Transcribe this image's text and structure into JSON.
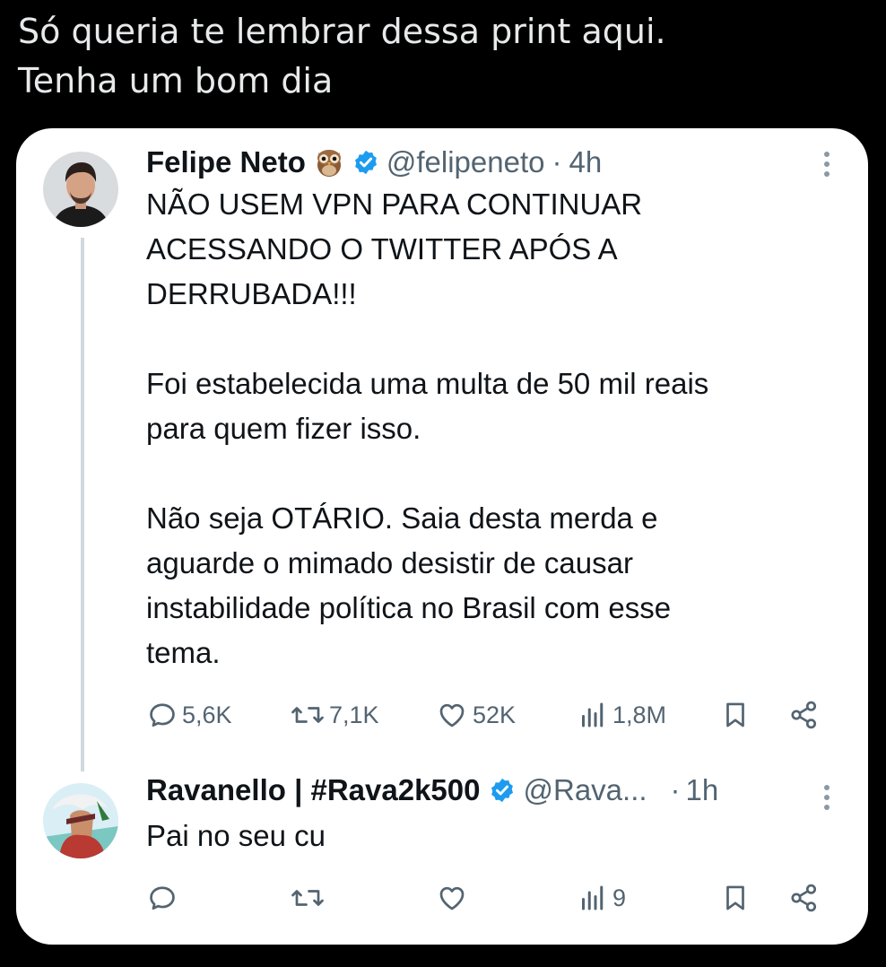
{
  "caption": {
    "line1": "Só queria te lembrar dessa print aqui.",
    "line2": "Tenha um bom dia"
  },
  "tweet1": {
    "name": "Felipe Neto",
    "handle": "@felipeneto",
    "separator": "·",
    "time": "4h",
    "text": "NÃO USEM VPN PARA CONTINUAR\nACESSANDO O TWITTER APÓS A\nDERRUBADA!!!\n\nFoi estabelecida uma multa de 50 mil reais\npara quem fizer isso.\n\nNão seja OTÁRIO. Saia desta merda e\naguarde o mimado desistir de causar\ninstabilidade política no Brasil com esse\ntema.",
    "replies": "5,6K",
    "retweets": "7,1K",
    "likes": "52K",
    "views": "1,8M",
    "icons": [
      "owl-emoji",
      "verified-badge-icon",
      "more-icon",
      "reply-icon",
      "retweet-icon",
      "like-icon",
      "views-icon",
      "bookmark-icon",
      "share-icon"
    ]
  },
  "tweet2": {
    "name": "Ravanello | #Rava2k500",
    "handle": "@Rava...",
    "separator": "·",
    "time": "1h",
    "text": "Pai no seu cu",
    "views": "9"
  },
  "colors": {
    "background": "#000000",
    "card": "#ffffff",
    "text": "#0f1419",
    "secondary": "#536471",
    "verified": "#1d9bf0",
    "thread_line": "#cfd9de"
  }
}
